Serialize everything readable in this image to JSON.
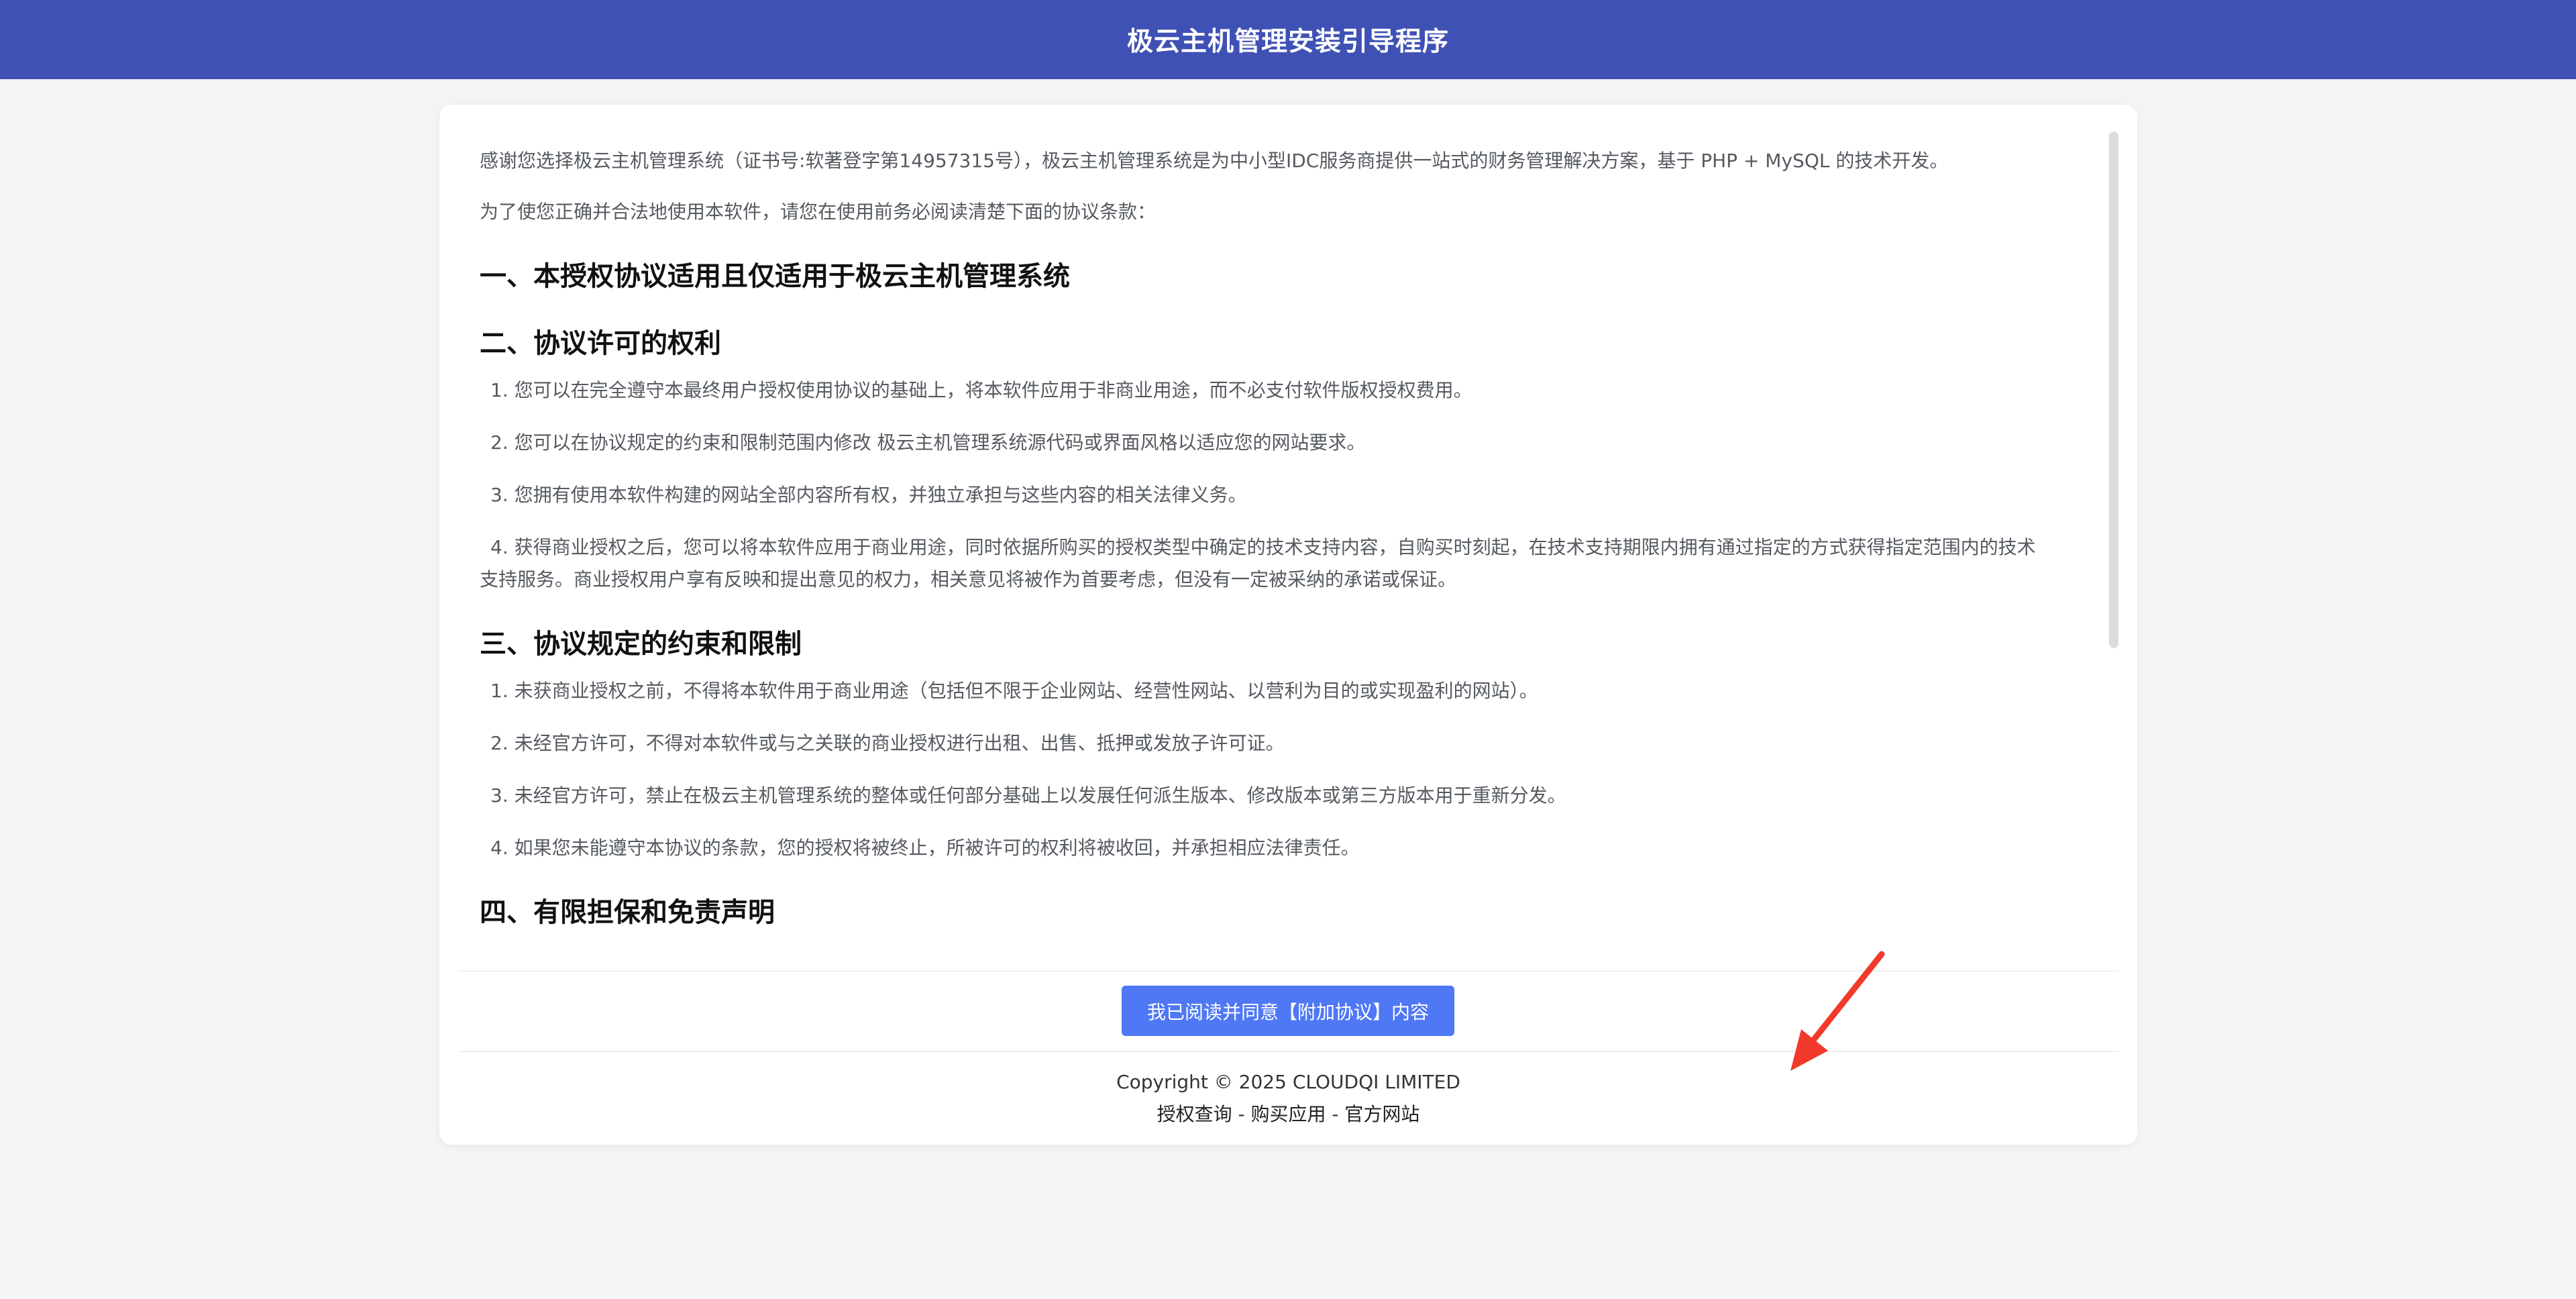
{
  "header": {
    "title": "极云主机管理安装引导程序"
  },
  "agreement": {
    "intro": [
      "感谢您选择极云主机管理系统（证书号:软著登字第14957315号），极云主机管理系统是为中小型IDC服务商提供一站式的财务管理解决方案，基于 PHP + MySQL 的技术开发。",
      "为了使您正确并合法地使用本软件，请您在使用前务必阅读清楚下面的协议条款："
    ],
    "sections": [
      {
        "title": "一、本授权协议适用且仅适用于极云主机管理系统",
        "items": []
      },
      {
        "title": "二、协议许可的权利",
        "items": [
          "1. 您可以在完全遵守本最终用户授权使用协议的基础上，将本软件应用于非商业用途，而不必支付软件版权授权费用。",
          "2. 您可以在协议规定的约束和限制范围内修改 极云主机管理系统源代码或界面风格以适应您的网站要求。",
          "3. 您拥有使用本软件构建的网站全部内容所有权，并独立承担与这些内容的相关法律义务。",
          "4. 获得商业授权之后，您可以将本软件应用于商业用途，同时依据所购买的授权类型中确定的技术支持内容，自购买时刻起，在技术支持期限内拥有通过指定的方式获得指定范围内的技术支持服务。商业授权用户享有反映和提出意见的权力，相关意见将被作为首要考虑，但没有一定被采纳的承诺或保证。"
        ]
      },
      {
        "title": "三、协议规定的约束和限制",
        "items": [
          "1. 未获商业授权之前，不得将本软件用于商业用途（包括但不限于企业网站、经营性网站、以营利为目的或实现盈利的网站）。",
          "2. 未经官方许可，不得对本软件或与之关联的商业授权进行出租、出售、抵押或发放子许可证。",
          "3. 未经官方许可，禁止在极云主机管理系统的整体或任何部分基础上以发展任何派生版本、修改版本或第三方版本用于重新分发。",
          "4. 如果您未能遵守本协议的条款，您的授权将被终止，所被许可的权利将被收回，并承担相应法律责任。"
        ]
      },
      {
        "title": "四、有限担保和免责声明",
        "items": []
      }
    ]
  },
  "agree_button": {
    "label": "我已阅读并同意【附加协议】内容"
  },
  "footer": {
    "copyright": "Copyright © 2025 CLOUDQI LIMITED",
    "links": [
      "授权查询",
      "购买应用",
      "官方网站"
    ],
    "separator": " - "
  },
  "colors": {
    "header_bg": "#3f51b5",
    "button_bg": "#4f78f5",
    "arrow": "#f23a2c"
  }
}
